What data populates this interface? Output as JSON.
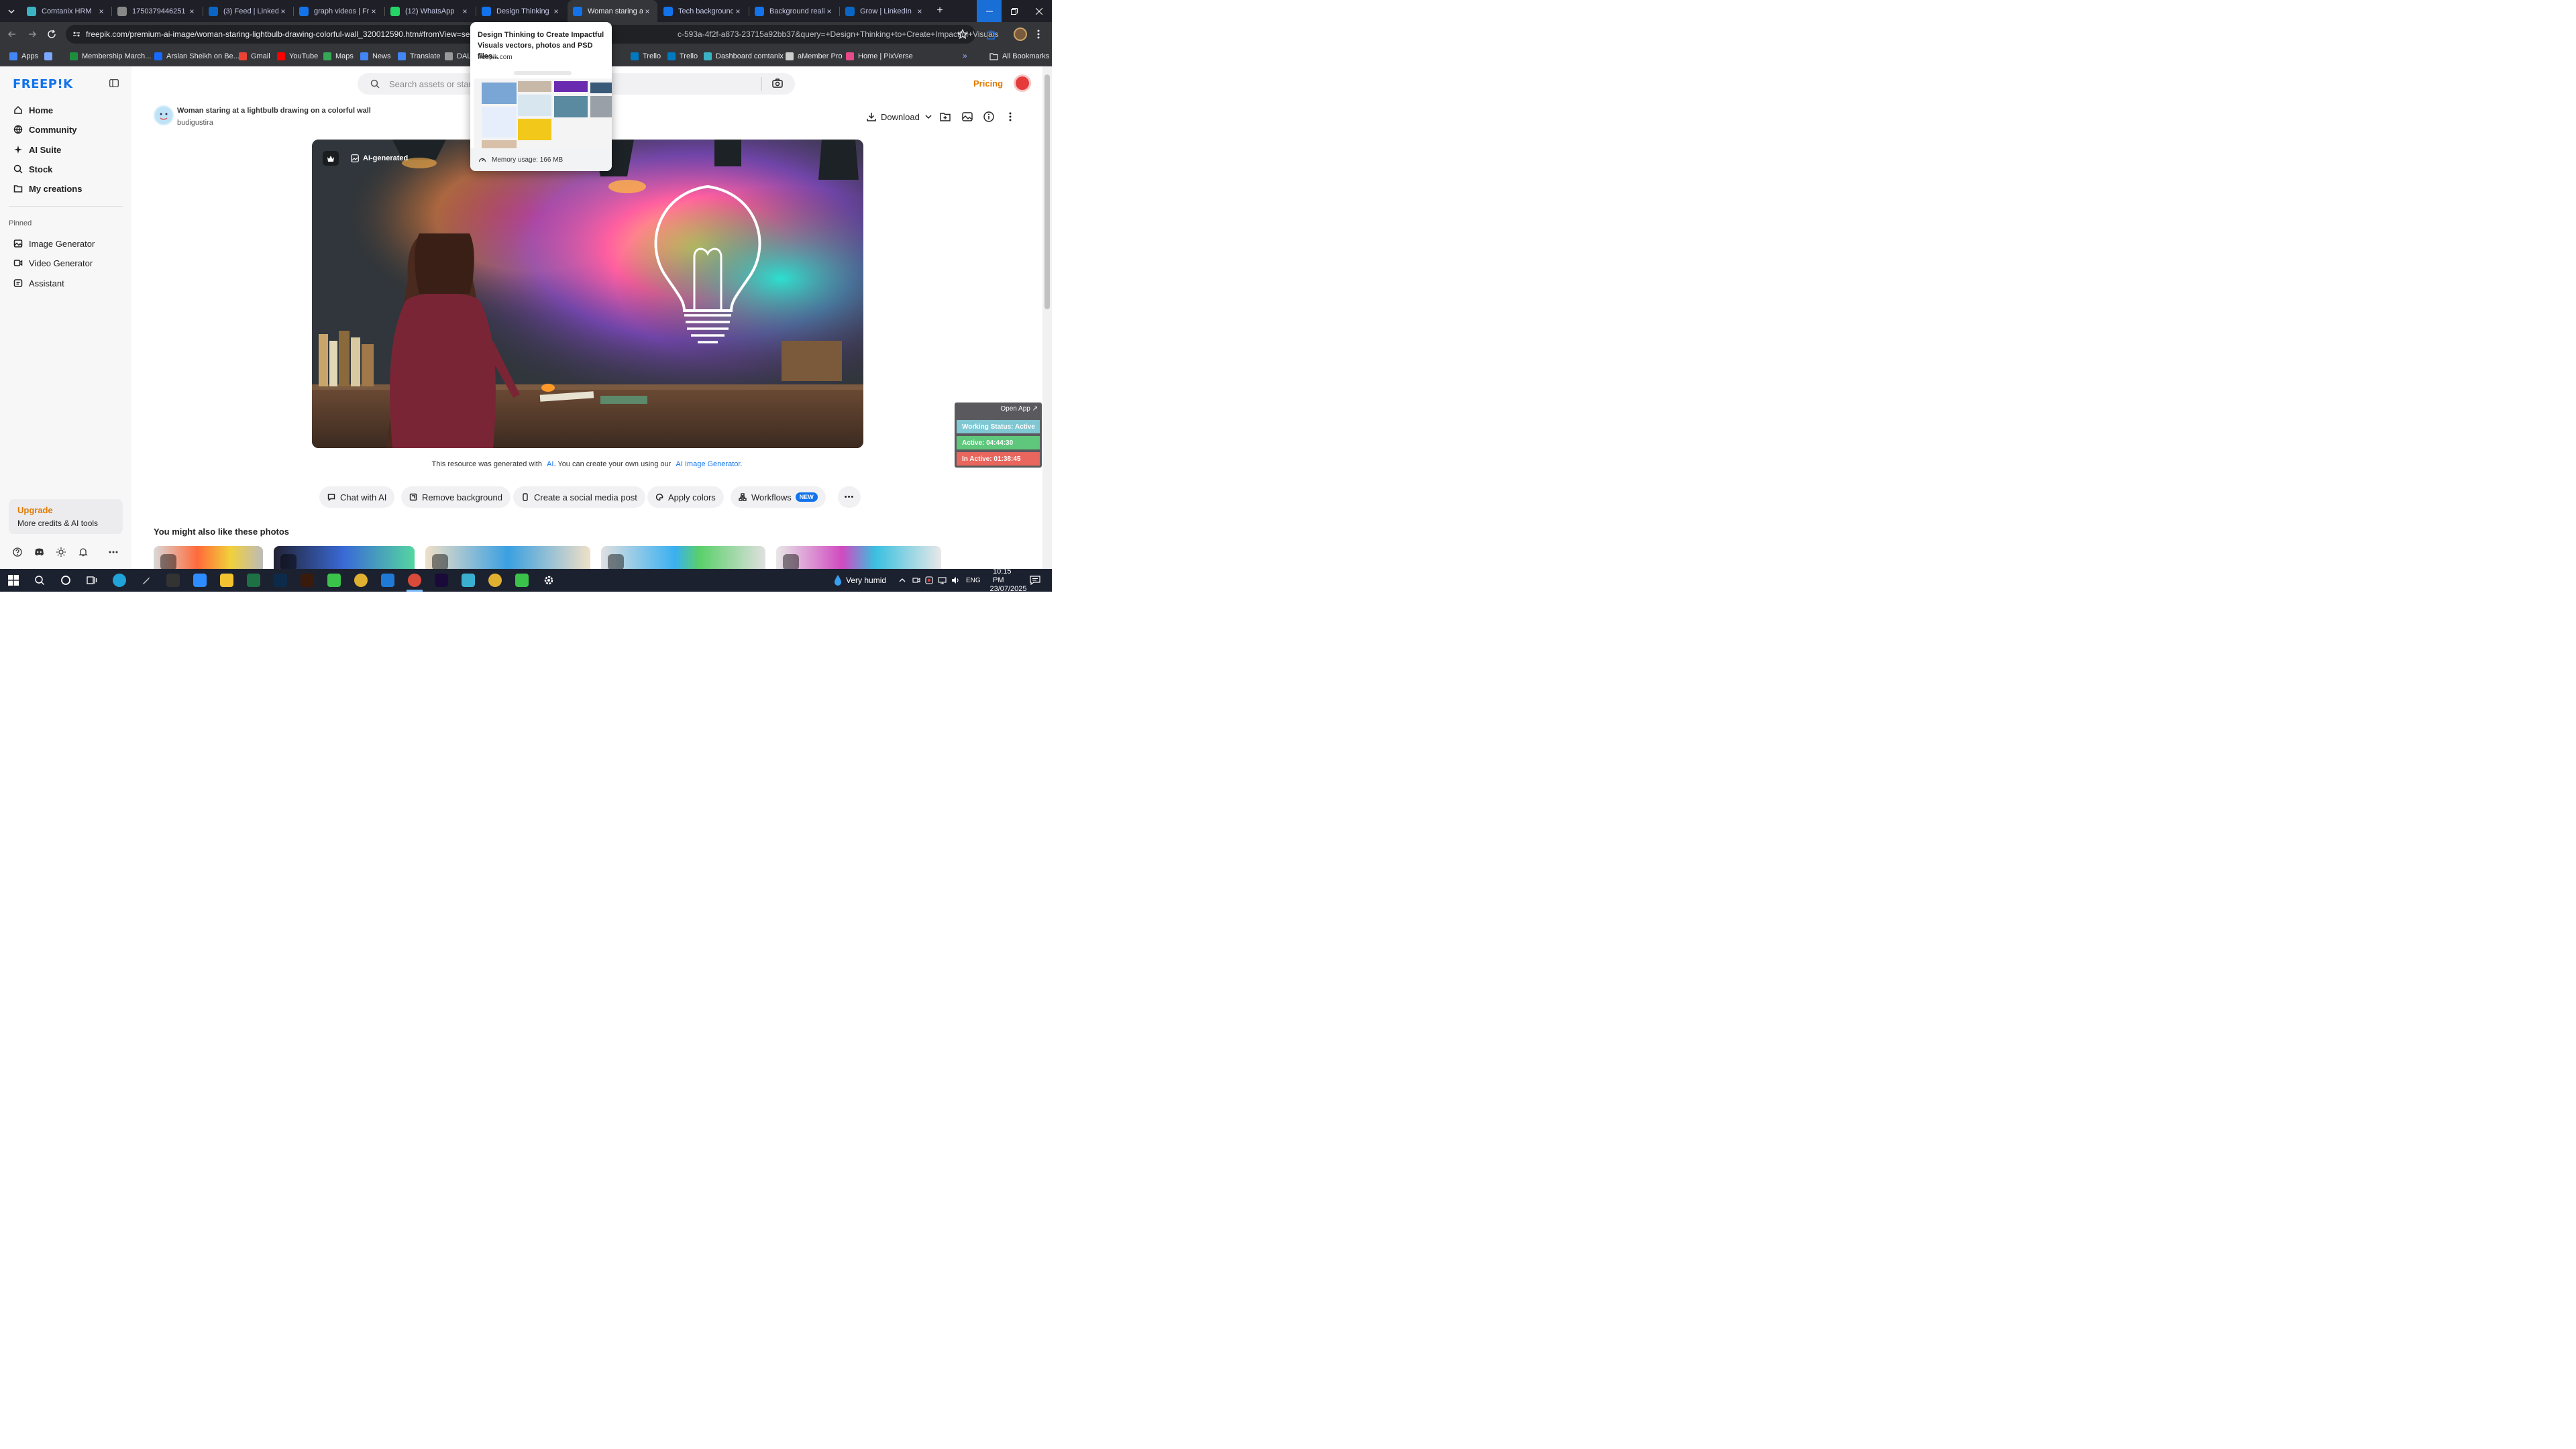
{
  "browser": {
    "tabs": [
      {
        "title": "Comtanix HRM",
        "favicon_color": "#3bb3c3",
        "active": false
      },
      {
        "title": "1750379446251 (",
        "favicon_color": "#888888",
        "active": false
      },
      {
        "title": "(3) Feed | LinkedIn",
        "favicon_color": "#0a66c2",
        "active": false
      },
      {
        "title": "graph videos | Free",
        "favicon_color": "#1273eb",
        "active": false
      },
      {
        "title": "(12) WhatsApp",
        "favicon_color": "#25d366",
        "active": false
      },
      {
        "title": "Design Thinking t",
        "favicon_color": "#1273eb",
        "active": false
      },
      {
        "title": "Woman staring at",
        "favicon_color": "#1273eb",
        "active": true
      },
      {
        "title": "Tech background",
        "favicon_color": "#1273eb",
        "active": false
      },
      {
        "title": "Background reali",
        "favicon_color": "#1273eb",
        "active": false
      },
      {
        "title": "Grow | LinkedIn",
        "favicon_color": "#0a66c2",
        "active": false
      }
    ],
    "new_tab": "+",
    "url": "freepik.com/premium-ai-image/woman-staring-lightbulb-drawing-colorful-wall_320012590.htm#fromView=search",
    "url_tail": "c-593a-4f2f-a873-23715a92bb37&query=+Design+Thinking+to+Create+Impactful+Visuals",
    "bookmarks": [
      {
        "label": "Apps",
        "color": "#4285f4"
      },
      {
        "label": "",
        "color": "#7aa7ff"
      },
      {
        "label": "Membership March...",
        "color": "#1e8e3e"
      },
      {
        "label": "Arslan Sheikh on Be...",
        "color": "#1769ff"
      },
      {
        "label": "Gmail",
        "color": "#ea4335"
      },
      {
        "label": "YouTube",
        "color": "#ff0000"
      },
      {
        "label": "Maps",
        "color": "#34a853"
      },
      {
        "label": "News",
        "color": "#4285f4"
      },
      {
        "label": "Translate",
        "color": "#4285f4"
      },
      {
        "label": "DALL",
        "color": "#999999"
      },
      {
        "label": "Trello",
        "color": "#0079bf"
      },
      {
        "label": "Trello",
        "color": "#0079bf"
      },
      {
        "label": "Dashboard comtanix",
        "color": "#3bb3c3"
      },
      {
        "label": "aMember Pro",
        "color": "#cccccc"
      },
      {
        "label": "Home | PixVerse",
        "color": "#e64a8b"
      }
    ],
    "all_bookmarks": "All Bookmarks"
  },
  "tab_popup": {
    "title": "Design Thinking to Create Impactful Visuals vectors, photos and PSD files...",
    "domain": "freepik.com",
    "memory": "Memory usage: 166 MB"
  },
  "sidebar": {
    "logo": "FREEP!K",
    "nav": [
      {
        "label": "Home",
        "icon": "home-icon"
      },
      {
        "label": "Community",
        "icon": "globe-icon"
      },
      {
        "label": "AI Suite",
        "icon": "sparkle-icon"
      },
      {
        "label": "Stock",
        "icon": "search-icon"
      },
      {
        "label": "My creations",
        "icon": "folder-icon"
      }
    ],
    "pinned_heading": "Pinned",
    "pinned": [
      {
        "label": "Image Generator",
        "icon": "image-icon"
      },
      {
        "label": "Video Generator",
        "icon": "video-icon"
      },
      {
        "label": "Assistant",
        "icon": "assistant-icon"
      }
    ],
    "upgrade_title": "Upgrade",
    "upgrade_sub": "More credits & AI tools"
  },
  "header": {
    "search_placeholder": "Search assets or star",
    "pricing": "Pricing"
  },
  "asset": {
    "title": "Woman staring at a lightbulb drawing on a colorful wall",
    "author": "budigustira",
    "download": "Download",
    "badge": "AI-generated",
    "note_pre": "This resource was generated with",
    "note_ai": "AI",
    "note_mid": ". You can create your own using our",
    "note_link": "AI Image Generator",
    "note_end": "."
  },
  "actions": [
    {
      "label": "Chat with AI",
      "icon": "chat-icon"
    },
    {
      "label": "Remove background",
      "icon": "eraser-icon"
    },
    {
      "label": "Create a social media post",
      "icon": "phone-icon"
    },
    {
      "label": "Apply colors",
      "icon": "palette-icon"
    },
    {
      "label": "Workflows",
      "icon": "workflow-icon",
      "badge": "NEW"
    }
  ],
  "more_actions": "•••",
  "related_heading": "You might also like these photos",
  "widget": {
    "open_app": "Open App ↗",
    "status": "Working Status: Active",
    "active": "Active: 04:44:30",
    "inactive": "In Active: 01:38:45",
    "colors": {
      "status": "#7fc7d2",
      "active": "#5fc77c",
      "inactive": "#e8665e"
    }
  },
  "taskbar": {
    "weather": "Very humid",
    "lang": "ENG",
    "time": "10:15 PM",
    "date": "23/07/2025"
  },
  "colors": {
    "accent": "#1273eb",
    "pricing": "#e07a00"
  }
}
